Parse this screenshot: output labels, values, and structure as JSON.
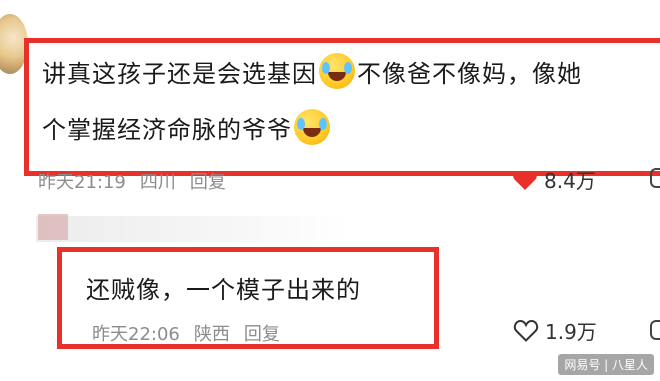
{
  "comment": {
    "line1_text": "讲真这孩子还是会选基因",
    "line1_after_emoji": "不像爸不像妈，像她",
    "line2_text": "个掌握经济命脉的爷爷",
    "time": "昨天21:19",
    "location": "四川",
    "reply_label": "回复",
    "likes": "8.4万",
    "emoji_1": "laughing-crying-emoji",
    "emoji_2": "rolling-laughing-emoji"
  },
  "reply": {
    "text": "还贼像，一个模子出来的",
    "time": "昨天22:06",
    "location": "陕西",
    "reply_label": "回复",
    "likes": "1.9万"
  },
  "watermark": "网易号 | 八星人",
  "colors": {
    "highlight_border": "#e8312a",
    "heart_liked": "#e8312a",
    "meta_text": "#8c8c8c"
  }
}
